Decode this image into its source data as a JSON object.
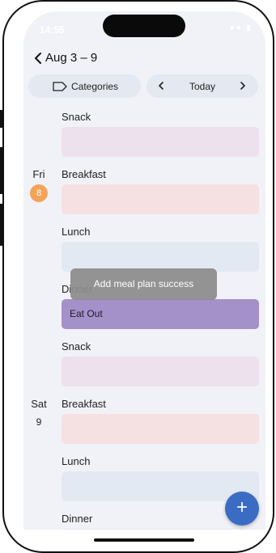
{
  "status_bar": {
    "time": "14:55",
    "icons": "wifi battery"
  },
  "header": {
    "back_icon": "chevron-left-icon",
    "title": "Aug 3 – 9"
  },
  "controls": {
    "categories_icon": "tag-icon",
    "categories_label": "Categories",
    "prev_icon": "chevron-left-icon",
    "today_label": "Today",
    "next_icon": "chevron-right-icon"
  },
  "days": [
    {
      "day": "Fri",
      "date": "8",
      "highlighted": true,
      "meals": [
        {
          "label": "Breakfast",
          "entry": ""
        },
        {
          "label": "Lunch",
          "entry": ""
        },
        {
          "label": "Dinner",
          "entry": "Eat Out"
        },
        {
          "label": "Snack",
          "entry": ""
        }
      ]
    },
    {
      "day": "Sat",
      "date": "9",
      "highlighted": false,
      "meals": [
        {
          "label": "Breakfast",
          "entry": ""
        },
        {
          "label": "Lunch",
          "entry": ""
        },
        {
          "label": "Dinner",
          "entry": ""
        }
      ]
    }
  ],
  "previous_snack_label": "Snack",
  "toast": "Add meal plan success",
  "fab": {
    "icon": "plus-icon",
    "glyph": "+"
  },
  "colors": {
    "background": "#f1f2f7",
    "snack": "#ece1ec",
    "breakfast": "#f5e1e2",
    "lunch": "#e2e9f3",
    "dinner_filled": "#a591c9",
    "today_badge": "#f2a45a",
    "fab": "#3b6cc4"
  }
}
